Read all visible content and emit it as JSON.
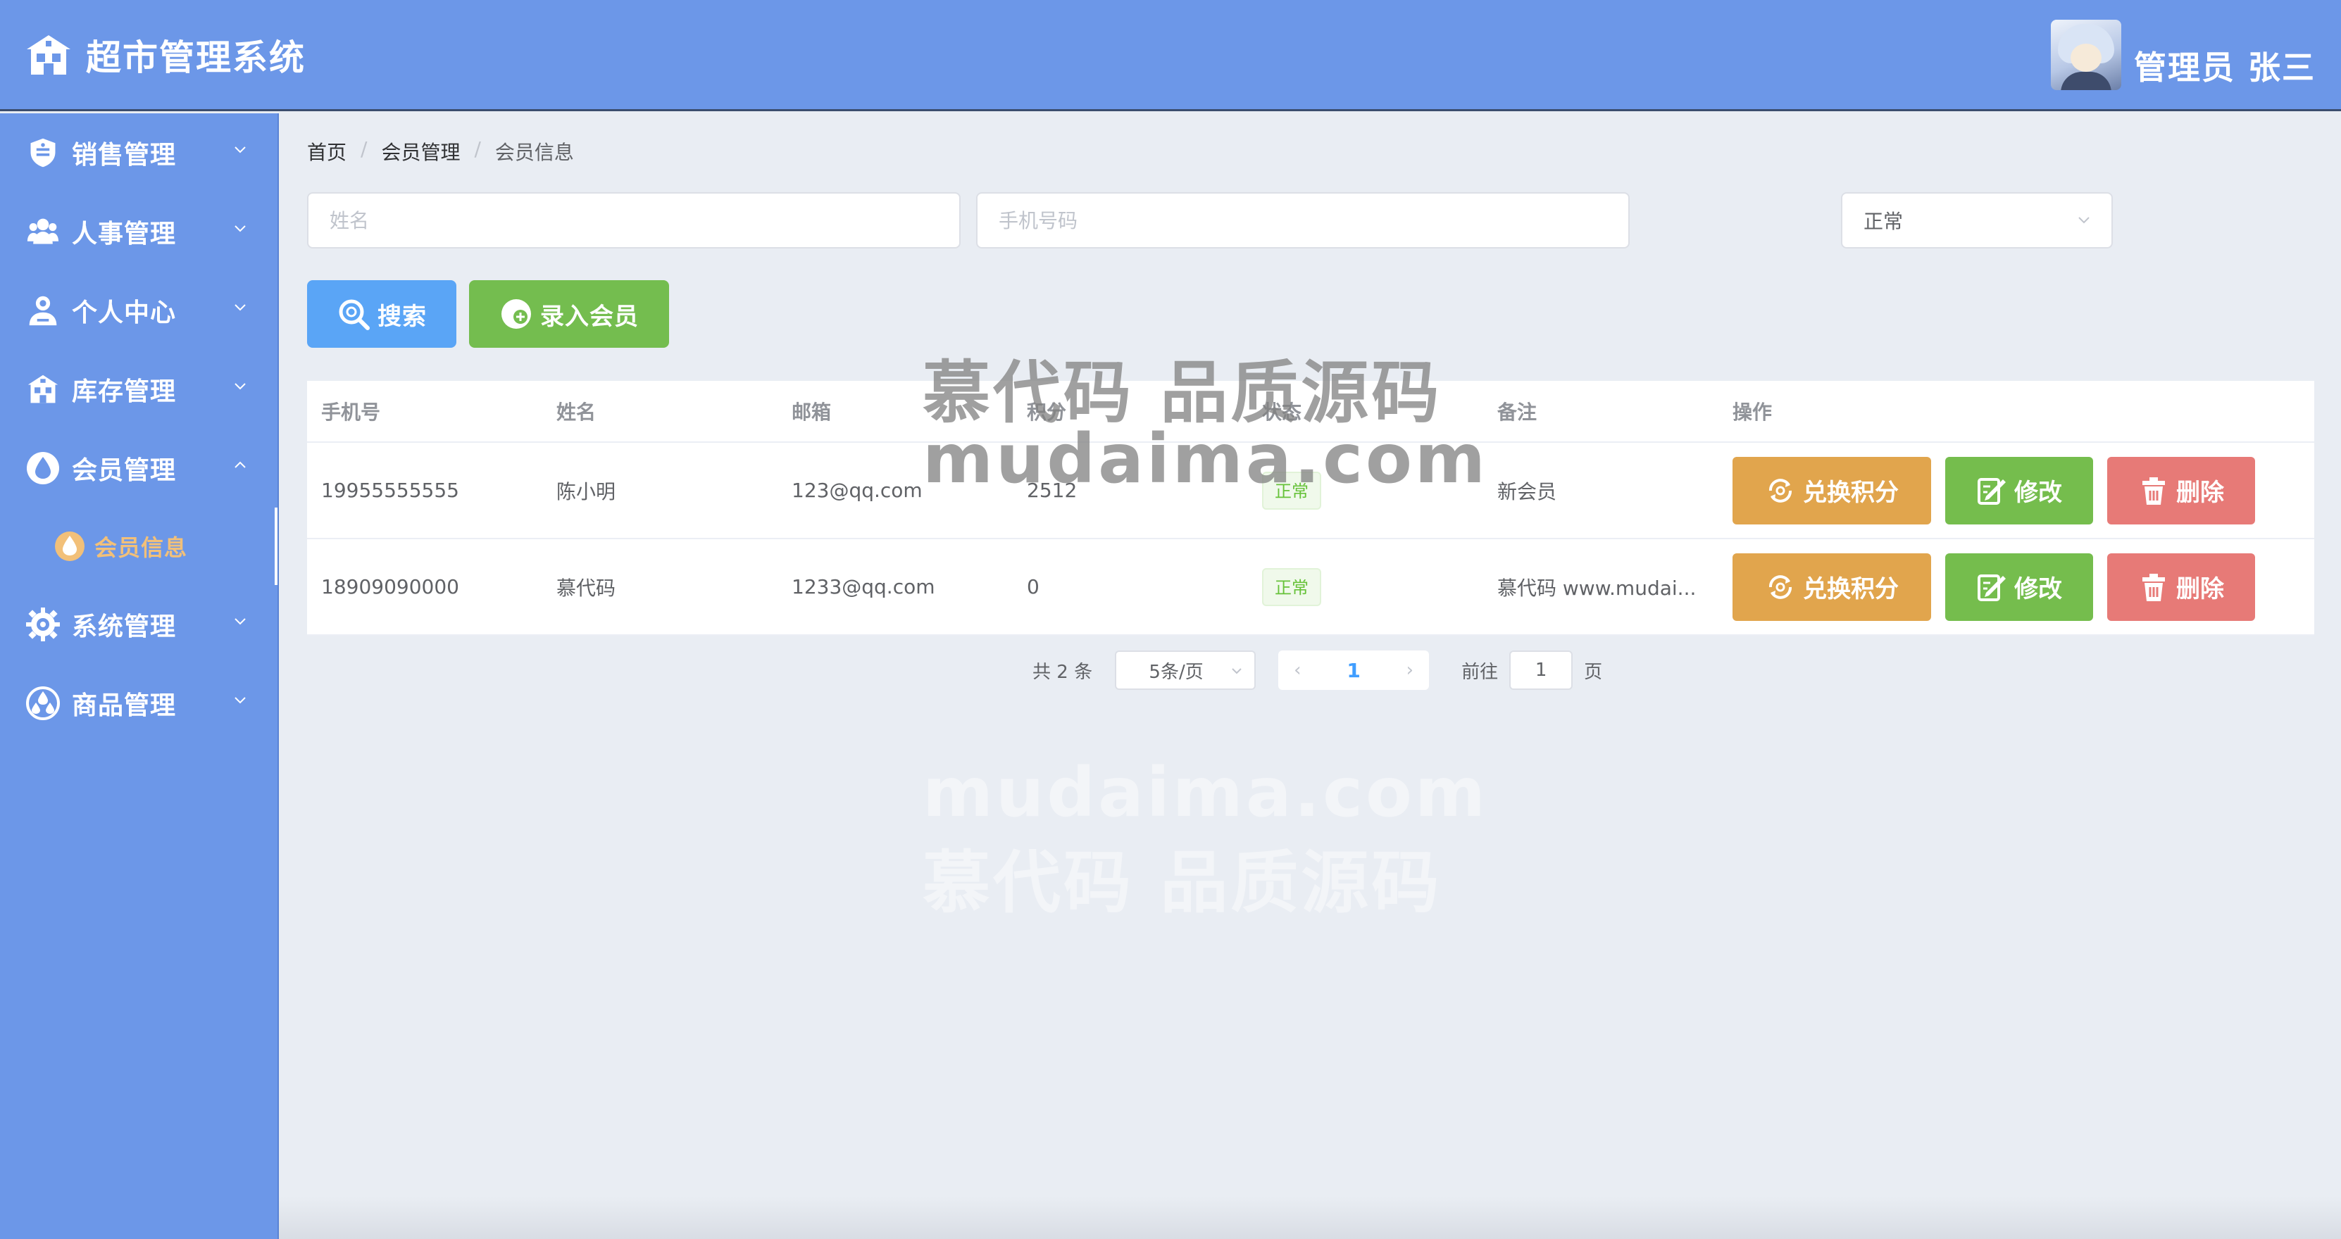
{
  "header": {
    "title": "超市管理系统",
    "user_label": "管理员 张三"
  },
  "sidebar": {
    "items": [
      {
        "label": "销售管理",
        "icon": "shield-icon",
        "expanded": false
      },
      {
        "label": "人事管理",
        "icon": "people-icon",
        "expanded": false
      },
      {
        "label": "个人中心",
        "icon": "user-icon",
        "expanded": false
      },
      {
        "label": "库存管理",
        "icon": "warehouse-icon",
        "expanded": false
      },
      {
        "label": "会员管理",
        "icon": "drop-icon",
        "expanded": true,
        "children": [
          {
            "label": "会员信息",
            "icon": "drop-icon",
            "active": true
          }
        ]
      },
      {
        "label": "系统管理",
        "icon": "gear-icon",
        "expanded": false
      },
      {
        "label": "商品管理",
        "icon": "goods-icon",
        "expanded": false
      }
    ]
  },
  "breadcrumb": [
    "首页",
    "会员管理",
    "会员信息"
  ],
  "filters": {
    "name_placeholder": "姓名",
    "phone_placeholder": "手机号码",
    "status_value": "正常"
  },
  "buttons": {
    "search": "搜索",
    "add_member": "录入会员"
  },
  "table": {
    "columns": [
      "手机号",
      "姓名",
      "邮箱",
      "积分",
      "状态",
      "备注",
      "操作"
    ],
    "rows": [
      {
        "phone": "19955555555",
        "name": "陈小明",
        "email": "123@qq.com",
        "points": "2512",
        "status": "正常",
        "note": "新会员"
      },
      {
        "phone": "18909090000",
        "name": "慕代码",
        "email": "1233@qq.com",
        "points": "0",
        "status": "正常",
        "note": "慕代码 www.mudai..."
      }
    ],
    "actions": {
      "exchange": "兑换积分",
      "edit": "修改",
      "delete": "删除"
    }
  },
  "pagination": {
    "total_text": "共 2 条",
    "page_size": "5条/页",
    "current_page": "1",
    "goto_label": "前往",
    "goto_value": "1",
    "page_suffix": "页"
  },
  "watermark": {
    "line1": "慕代码 品质源码",
    "line2": "mudaima.com"
  },
  "colors": {
    "primary_blue": "#6c97e8",
    "search_button": "#5aa5f6",
    "add_button": "#74bd4f",
    "exchange_button": "#e1a54d",
    "edit_button": "#75bd4d",
    "delete_button": "#e77a77",
    "active_submenu": "#f2c079"
  }
}
